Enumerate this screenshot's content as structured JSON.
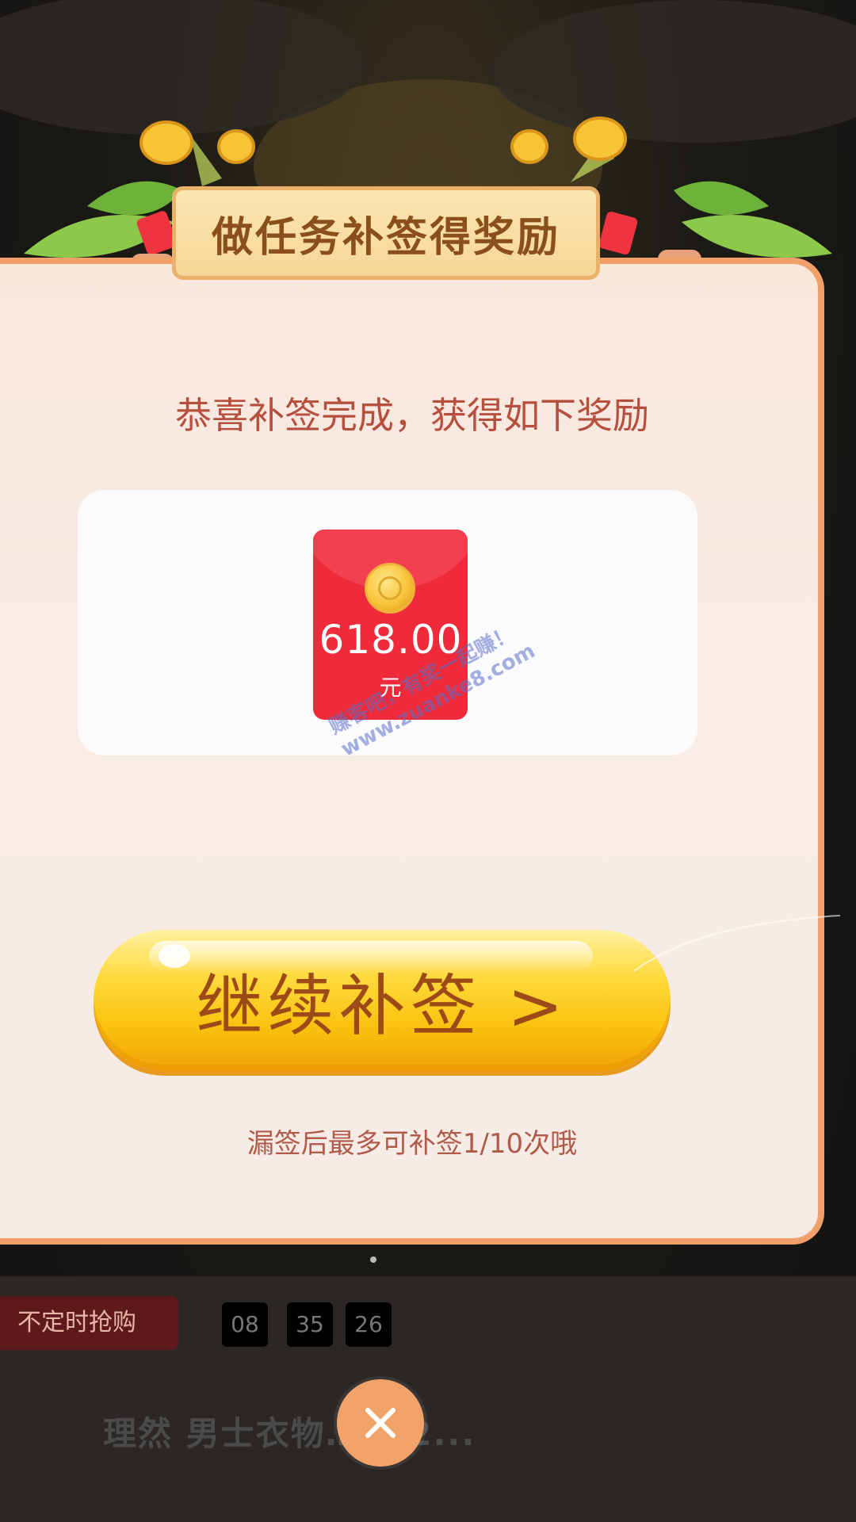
{
  "dialog": {
    "banner_title": "做任务补签得奖励",
    "subtitle": "恭喜补签完成，获得如下奖励",
    "reward": {
      "amount": "618.00",
      "unit": "元"
    },
    "continue_button": "继续补签 >",
    "hint": "漏签后最多可补签1/10次哦"
  },
  "watermark": {
    "line1": "赚客吧，有奖一起赚！",
    "line2": "www.zuanke8.com"
  },
  "background": {
    "tag": "不定时抢购",
    "timer": [
      "08",
      "35",
      "26"
    ],
    "product_title": "理然 男士衣物…水 2..."
  },
  "colors": {
    "modal_border": "#f2a06a",
    "banner_text": "#8a4f1a",
    "subtitle_text": "#b64f3d",
    "envelope": "#ef2a3b",
    "button_gold": "#f9c10e",
    "close_button": "#f2a36a"
  }
}
